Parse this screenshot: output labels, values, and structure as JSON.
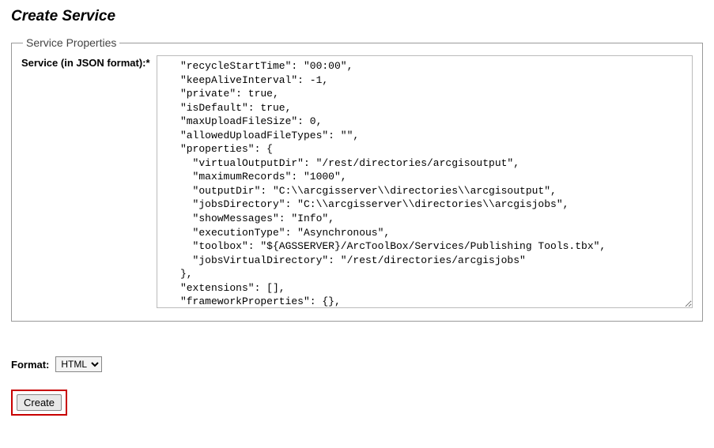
{
  "page": {
    "title": "Create Service"
  },
  "fieldset": {
    "legend": "Service Properties",
    "label": "Service (in JSON format):*",
    "textarea_value": "   \"recycleStartTime\": \"00:00\",\n   \"keepAliveInterval\": -1,\n   \"private\": true,\n   \"isDefault\": true,\n   \"maxUploadFileSize\": 0,\n   \"allowedUploadFileTypes\": \"\",\n   \"properties\": {\n     \"virtualOutputDir\": \"/rest/directories/arcgisoutput\",\n     \"maximumRecords\": \"1000\",\n     \"outputDir\": \"C:\\\\arcgisserver\\\\directories\\\\arcgisoutput\",\n     \"jobsDirectory\": \"C:\\\\arcgisserver\\\\directories\\\\arcgisjobs\",\n     \"showMessages\": \"Info\",\n     \"executionType\": \"Asynchronous\",\n     \"toolbox\": \"${AGSSERVER}/ArcToolBox/Services/Publishing Tools.tbx\",\n     \"jobsVirtualDirectory\": \"/rest/directories/arcgisjobs\"\n   },\n   \"extensions\": [],\n   \"frameworkProperties\": {},\n   \"datasets\": []\n}"
  },
  "format": {
    "label": "Format:",
    "selected": "HTML",
    "options": [
      "HTML"
    ]
  },
  "buttons": {
    "create": "Create"
  }
}
